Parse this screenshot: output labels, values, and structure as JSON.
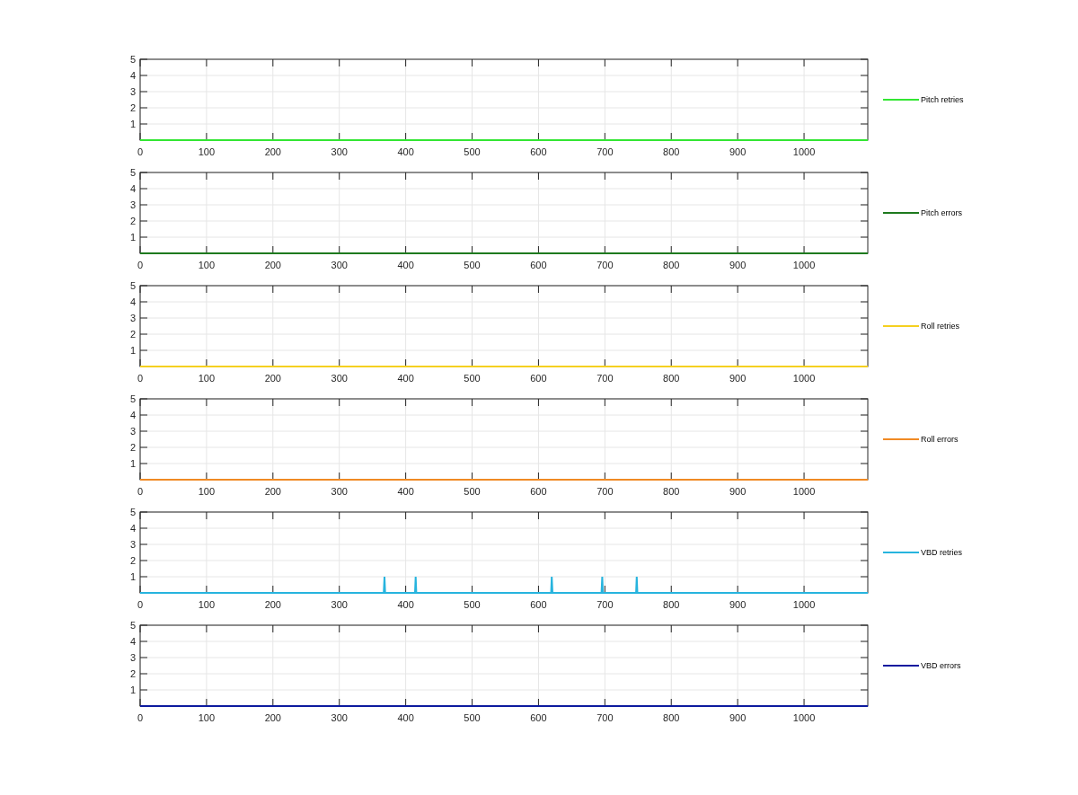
{
  "figure": {
    "subplots": [
      {
        "chart_data": {
          "type": "line",
          "grid": true,
          "x": [
            0,
            1096
          ],
          "series": [
            {
              "name": "Pitch retries",
              "color": "#33e633",
              "values": [
                0,
                0
              ]
            }
          ],
          "xlim": [
            0,
            1096
          ],
          "ylim": [
            0,
            5
          ],
          "xticks": [
            0,
            100,
            200,
            300,
            400,
            500,
            600,
            700,
            800,
            900,
            1000
          ],
          "yticks": [
            1,
            2,
            3,
            4,
            5
          ]
        }
      },
      {
        "chart_data": {
          "type": "line",
          "grid": true,
          "x": [
            0,
            1096
          ],
          "series": [
            {
              "name": "Pitch errors",
              "color": "#1e7a1e",
              "values": [
                0,
                0
              ]
            }
          ],
          "xlim": [
            0,
            1096
          ],
          "ylim": [
            0,
            5
          ],
          "xticks": [
            0,
            100,
            200,
            300,
            400,
            500,
            600,
            700,
            800,
            900,
            1000
          ],
          "yticks": [
            1,
            2,
            3,
            4,
            5
          ]
        }
      },
      {
        "chart_data": {
          "type": "line",
          "grid": true,
          "x": [
            0,
            1096
          ],
          "series": [
            {
              "name": "Roll retries",
              "color": "#f5d020",
              "values": [
                0,
                0
              ]
            }
          ],
          "xlim": [
            0,
            1096
          ],
          "ylim": [
            0,
            5
          ],
          "xticks": [
            0,
            100,
            200,
            300,
            400,
            500,
            600,
            700,
            800,
            900,
            1000
          ],
          "yticks": [
            1,
            2,
            3,
            4,
            5
          ]
        }
      },
      {
        "chart_data": {
          "type": "line",
          "grid": true,
          "x": [
            0,
            1096
          ],
          "series": [
            {
              "name": "Roll errors",
              "color": "#f08a24",
              "values": [
                0,
                0
              ]
            }
          ],
          "xlim": [
            0,
            1096
          ],
          "ylim": [
            0,
            5
          ],
          "xticks": [
            0,
            100,
            200,
            300,
            400,
            500,
            600,
            700,
            800,
            900,
            1000
          ],
          "yticks": [
            1,
            2,
            3,
            4,
            5
          ]
        }
      },
      {
        "chart_data": {
          "type": "line",
          "grid": true,
          "x": [
            0,
            367,
            368,
            369,
            414,
            415,
            416,
            619,
            620,
            621,
            695,
            696,
            697,
            747,
            748,
            749,
            1096
          ],
          "series": [
            {
              "name": "VBD retries",
              "color": "#27b4de",
              "values": [
                0,
                0,
                1,
                0,
                0,
                1,
                0,
                0,
                1,
                0,
                0,
                1,
                0,
                0,
                1,
                0,
                0
              ]
            }
          ],
          "xlim": [
            0,
            1096
          ],
          "ylim": [
            0,
            5
          ],
          "xticks": [
            0,
            100,
            200,
            300,
            400,
            500,
            600,
            700,
            800,
            900,
            1000
          ],
          "yticks": [
            1,
            2,
            3,
            4,
            5
          ]
        }
      },
      {
        "chart_data": {
          "type": "line",
          "grid": true,
          "x": [
            0,
            1096
          ],
          "series": [
            {
              "name": "VBD errors",
              "color": "#0c1a9e",
              "values": [
                0,
                0
              ]
            }
          ],
          "xlim": [
            0,
            1096
          ],
          "ylim": [
            0,
            5
          ],
          "xticks": [
            0,
            100,
            200,
            300,
            400,
            500,
            600,
            700,
            800,
            900,
            1000
          ],
          "yticks": [
            1,
            2,
            3,
            4,
            5
          ]
        }
      }
    ]
  }
}
